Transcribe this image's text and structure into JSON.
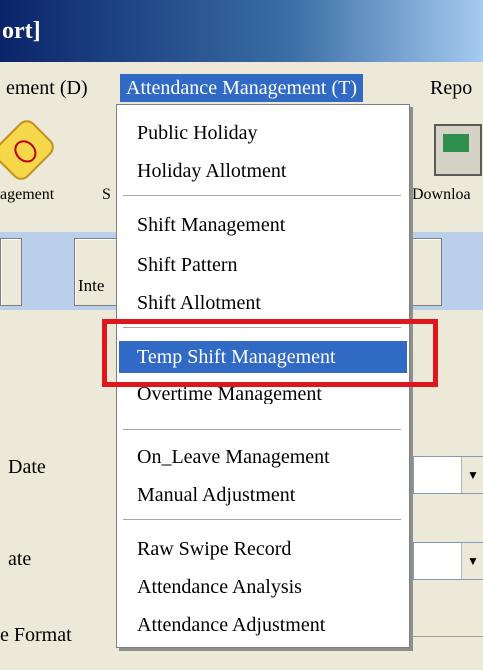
{
  "window": {
    "title_fragment": "ort]"
  },
  "menubar": {
    "items": [
      "ement (D)",
      "Attendance Management (T)",
      "Repo"
    ]
  },
  "toolbar": {
    "labels": [
      "agement",
      "S",
      "Downloa"
    ],
    "icons": [
      "ui-icon",
      "computer-download-icon"
    ]
  },
  "buttons": {
    "inte": "Inte"
  },
  "form": {
    "date_label": "Date",
    "ate_label": "ate",
    "format_label": "e Format",
    "combo_arrow": "▼"
  },
  "dropdown": {
    "items": [
      "Public Holiday",
      "Holiday Allotment",
      "Shift Management",
      "Shift Pattern",
      "Shift Allotment",
      "Temp Shift Management",
      "Overtime Management",
      "On_Leave Management",
      "Manual Adjustment",
      "Raw Swipe Record",
      "Attendance Analysis",
      "Attendance Adjustment"
    ],
    "highlighted": "Temp Shift Management"
  },
  "annotation": {
    "color": "#E0161F"
  },
  "colors": {
    "menu_highlight": "#316AC5",
    "button_row": "#B9CFEA"
  }
}
